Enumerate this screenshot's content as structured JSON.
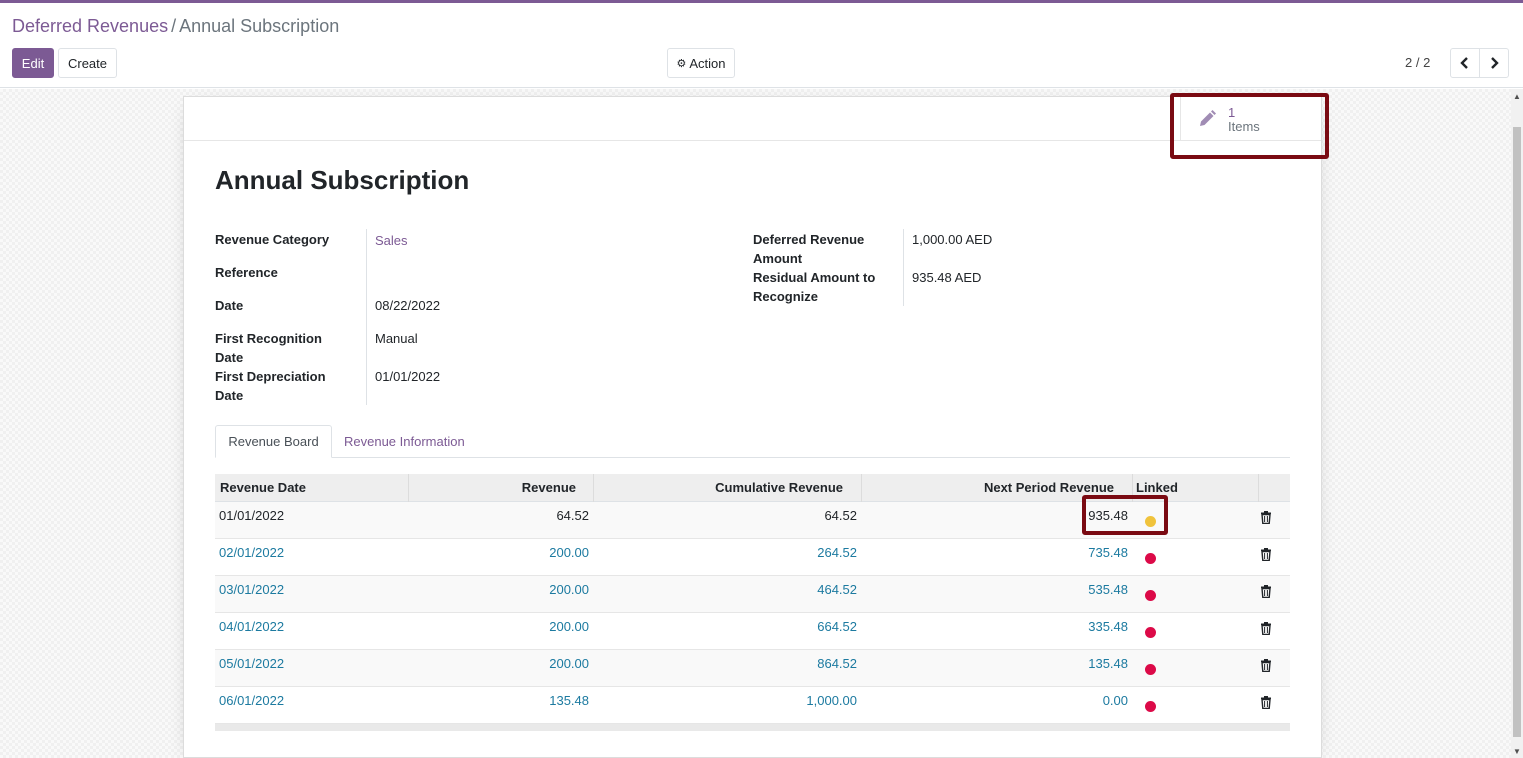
{
  "breadcrumb": {
    "parent": "Deferred Revenues",
    "separator": "/",
    "current": "Annual Subscription"
  },
  "toolbar": {
    "edit_label": "Edit",
    "create_label": "Create",
    "action_label": "Action"
  },
  "pager": {
    "value": "2 / 2"
  },
  "smart_button": {
    "value": "1",
    "label": "Items"
  },
  "record": {
    "title": "Annual Subscription",
    "left_fields": [
      {
        "label": "Revenue Category",
        "value": "Sales"
      },
      {
        "label": "Reference",
        "value": ""
      },
      {
        "label": "Date",
        "value": "08/22/2022"
      },
      {
        "label": "First Recognition Date",
        "value": "Manual"
      },
      {
        "label": "First Depreciation Date",
        "value": "01/01/2022"
      }
    ],
    "right_fields": [
      {
        "label": "Deferred Revenue Amount",
        "value": "1,000.00 AED"
      },
      {
        "label": "Residual Amount to Recognize",
        "value": "935.48 AED"
      }
    ]
  },
  "tabs": [
    {
      "label": "Revenue Board"
    },
    {
      "label": "Revenue Information"
    }
  ],
  "board": {
    "columns": [
      "Revenue Date",
      "Revenue",
      "Cumulative Revenue",
      "Next Period Revenue",
      "Linked"
    ],
    "rows": [
      {
        "date": "01/01/2022",
        "revenue": "64.52",
        "cumulative": "64.52",
        "next": "935.48",
        "status": "posted",
        "status_color": "#f0c33c"
      },
      {
        "date": "02/01/2022",
        "revenue": "200.00",
        "cumulative": "264.52",
        "next": "735.48",
        "status": "draft",
        "status_color": "#dc0a48"
      },
      {
        "date": "03/01/2022",
        "revenue": "200.00",
        "cumulative": "464.52",
        "next": "535.48",
        "status": "draft",
        "status_color": "#dc0a48"
      },
      {
        "date": "04/01/2022",
        "revenue": "200.00",
        "cumulative": "664.52",
        "next": "335.48",
        "status": "draft",
        "status_color": "#dc0a48"
      },
      {
        "date": "05/01/2022",
        "revenue": "200.00",
        "cumulative": "864.52",
        "next": "135.48",
        "status": "draft",
        "status_color": "#dc0a48"
      },
      {
        "date": "06/01/2022",
        "revenue": "135.48",
        "cumulative": "1,000.00",
        "next": "0.00",
        "status": "draft",
        "status_color": "#dc0a48"
      }
    ]
  },
  "colors": {
    "brand": "#7c5a94",
    "link_blue": "#1c7aa0",
    "highlight": "#7a0a12"
  },
  "icons": {
    "edit": "pencil-icon",
    "settings": "gear-icon",
    "prev": "chevron-left-icon",
    "next": "chevron-right-icon",
    "delete": "trash-icon"
  }
}
